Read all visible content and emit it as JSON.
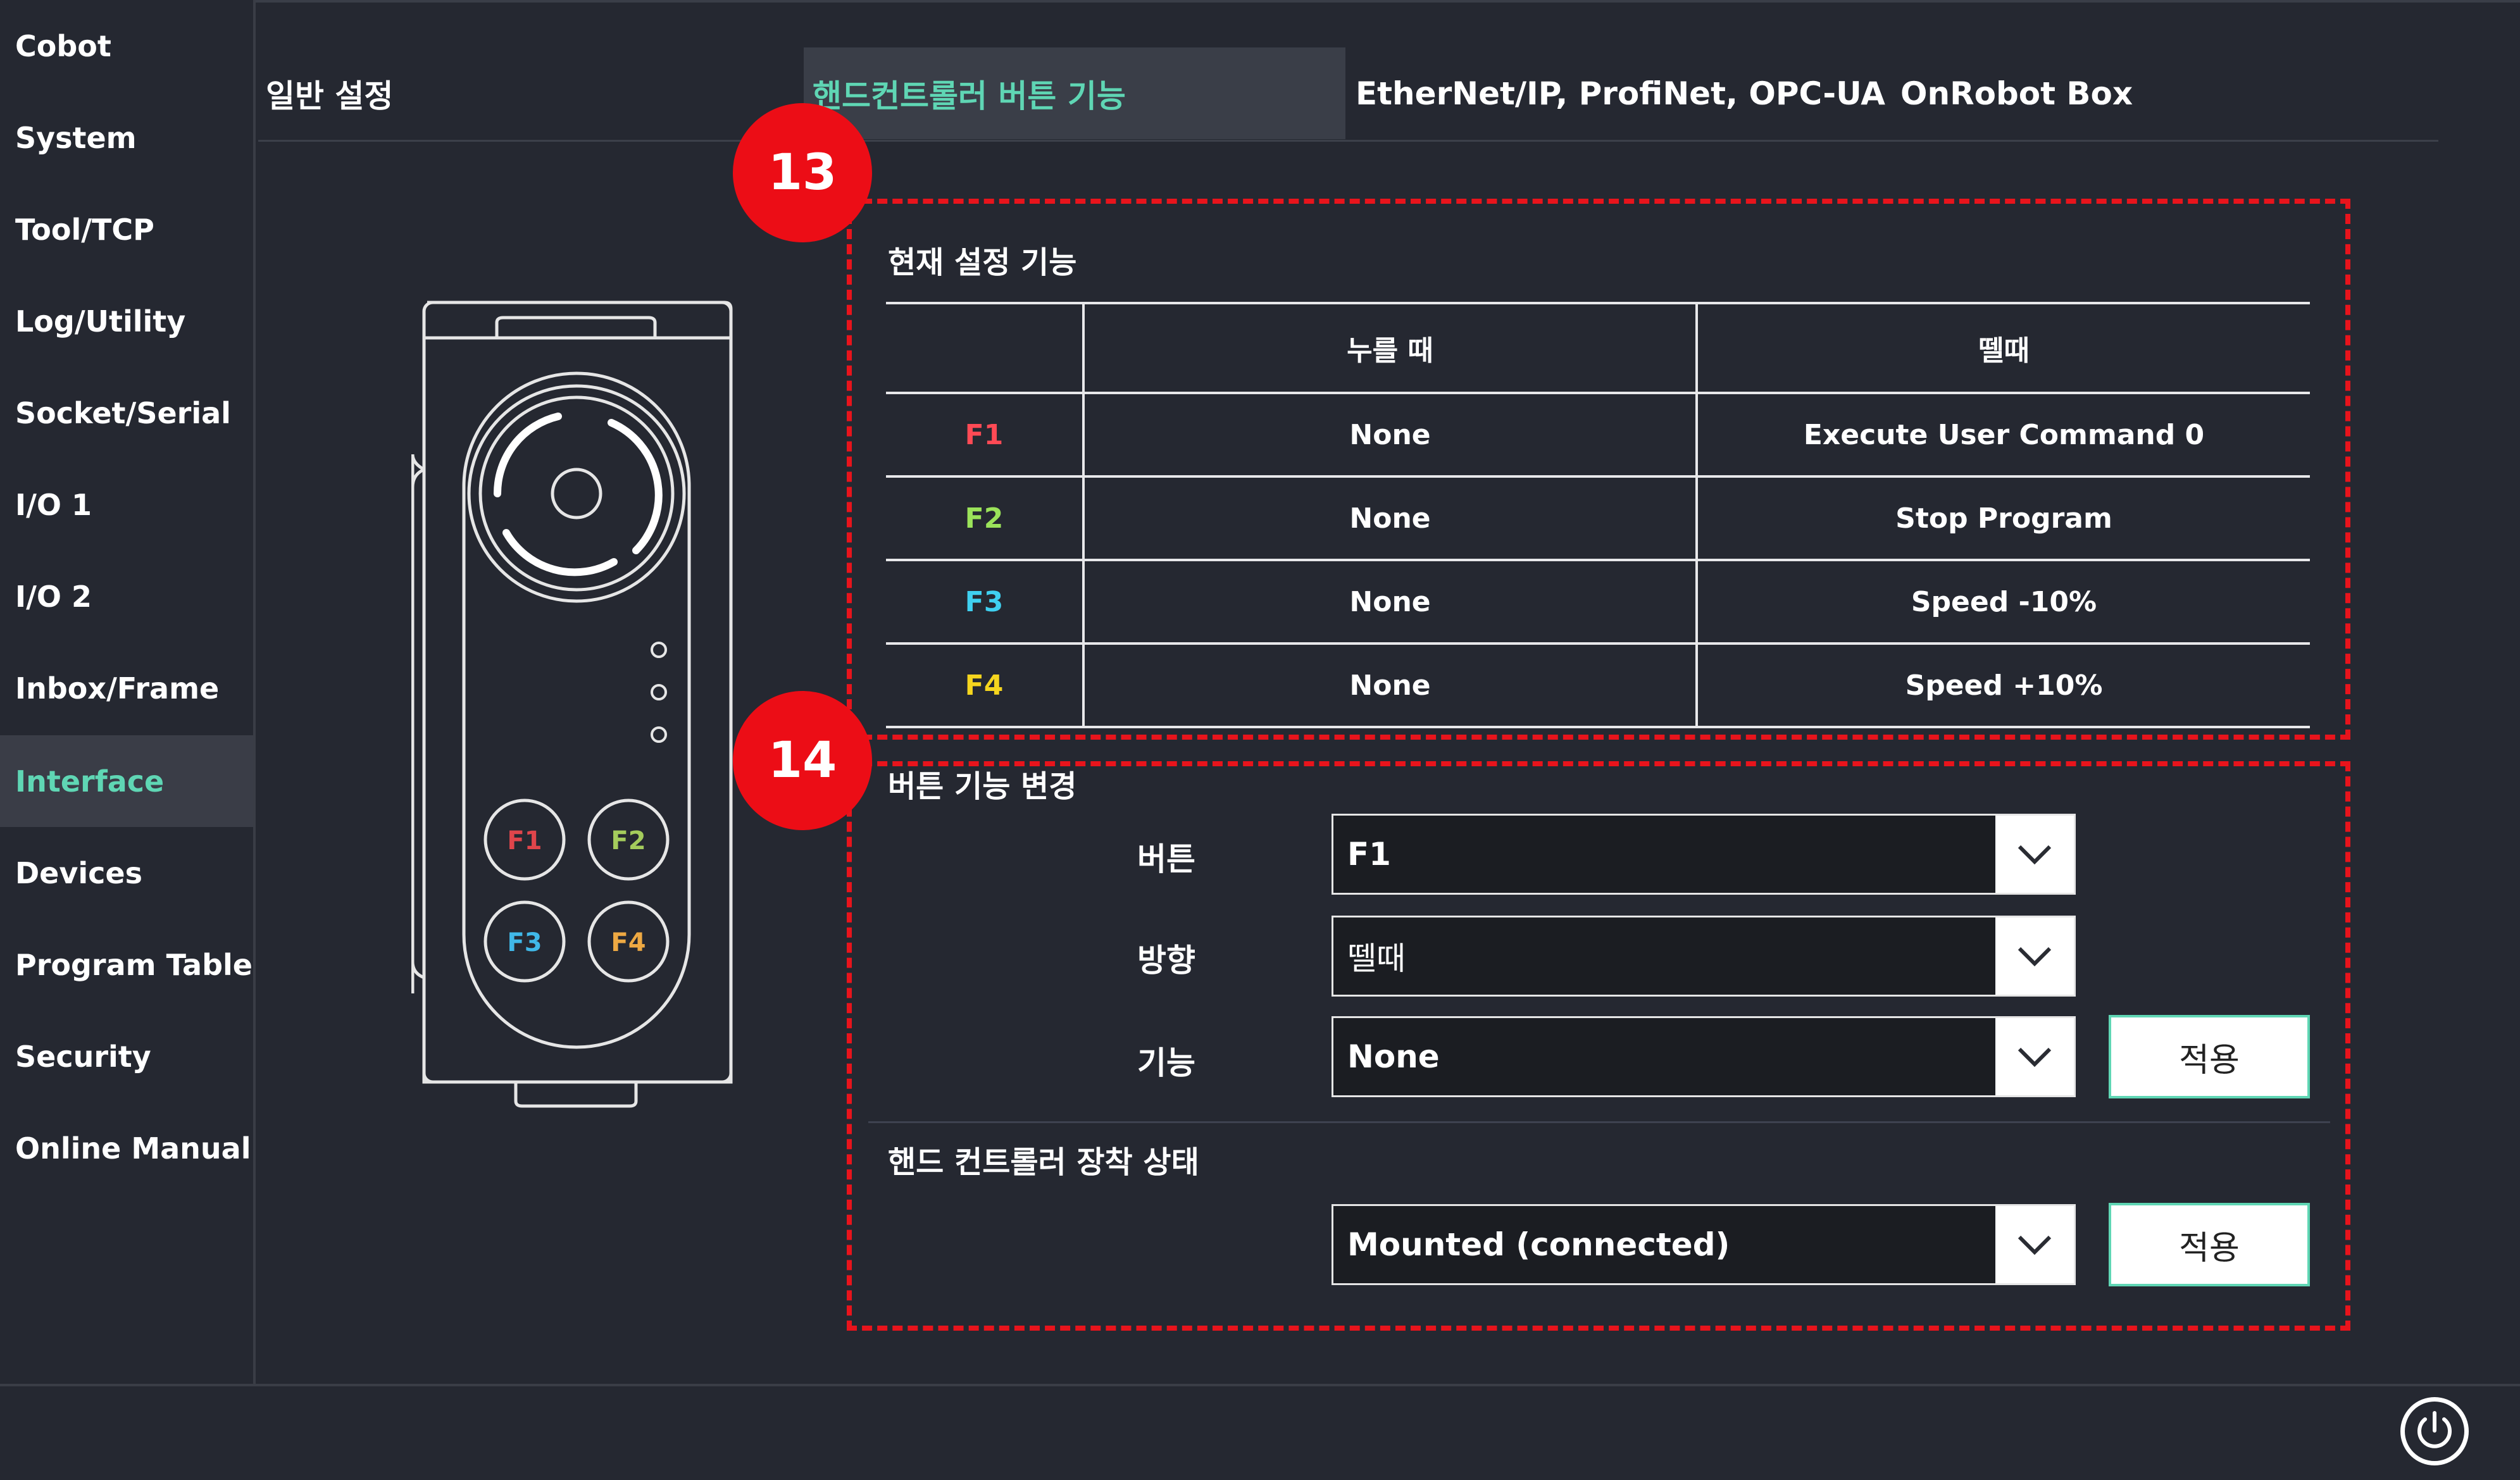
{
  "sidebar": {
    "items": [
      {
        "label": "Cobot"
      },
      {
        "label": "System"
      },
      {
        "label": "Tool/TCP"
      },
      {
        "label": "Log/Utility"
      },
      {
        "label": "Socket/Serial"
      },
      {
        "label": "I/O 1"
      },
      {
        "label": "I/O 2"
      },
      {
        "label": "Inbox/Frame"
      },
      {
        "label": "Interface"
      },
      {
        "label": "Devices"
      },
      {
        "label": "Program Table"
      },
      {
        "label": "Security"
      },
      {
        "label": "Online Manual"
      }
    ],
    "active_index": 8
  },
  "tabs": [
    {
      "label": "일반 설정"
    },
    {
      "label": "핸드컨트롤러 버튼 기능"
    },
    {
      "label": "EtherNet/IP, ProfiNet, OPC-UA"
    },
    {
      "label": "OnRobot Box"
    }
  ],
  "device": {
    "buttons": [
      {
        "label": "F1",
        "color": "#e0454b"
      },
      {
        "label": "F2",
        "color": "#a4cc5c"
      },
      {
        "label": "F3",
        "color": "#40b8e8"
      },
      {
        "label": "F4",
        "color": "#eea943"
      }
    ]
  },
  "badges": {
    "b13": "13",
    "b14": "14"
  },
  "current_section": {
    "title": "현재 설정 기능",
    "headers": [
      "",
      "누를 때",
      "뗄때"
    ],
    "rows": [
      {
        "key": "F1",
        "color": "#ff4a55",
        "press": "None",
        "release": "Execute User Command 0"
      },
      {
        "key": "F2",
        "color": "#9be35a",
        "press": "None",
        "release": "Stop Program"
      },
      {
        "key": "F3",
        "color": "#3fd0f0",
        "press": "None",
        "release": "Speed -10%"
      },
      {
        "key": "F4",
        "color": "#f5d51e",
        "press": "None",
        "release": "Speed +10%"
      }
    ]
  },
  "change_section": {
    "title": "버튼 기능 변경",
    "button_label": "버튼",
    "button_value": "F1",
    "direction_label": "방향",
    "direction_value": "뗄때",
    "function_label": "기능",
    "function_value": "None",
    "apply_label": "적용"
  },
  "mount_section": {
    "title": "핸드 컨트롤러 장착 상태",
    "value": "Mounted (connected)",
    "apply_label": "적용"
  },
  "colors": {
    "accent": "#5fd6b4",
    "highlight_box": "#e8141c",
    "badge": "#ec0d16"
  }
}
